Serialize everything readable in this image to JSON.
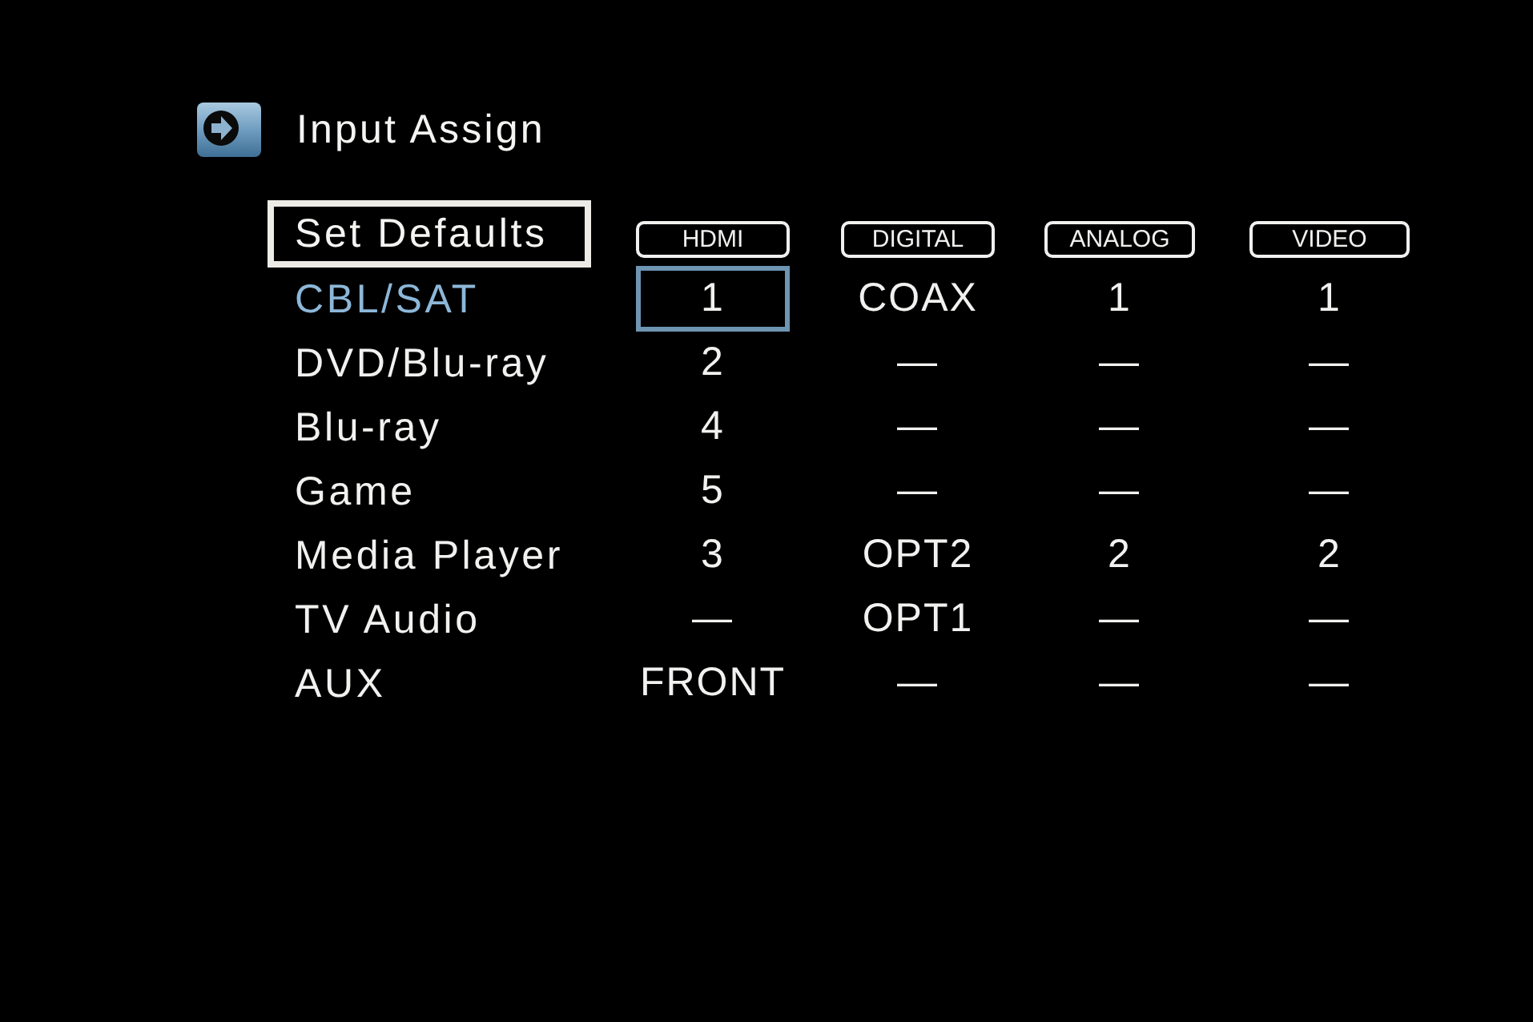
{
  "header": {
    "title": "Input Assign"
  },
  "set_defaults": {
    "label": "Set Defaults"
  },
  "columns": [
    {
      "label": "HDMI"
    },
    {
      "label": "DIGITAL"
    },
    {
      "label": "ANALOG"
    },
    {
      "label": "VIDEO"
    }
  ],
  "rows": [
    {
      "source": "CBL/SAT",
      "selected": true,
      "cells": [
        {
          "value": "1",
          "selected": true
        },
        {
          "value": "COAX",
          "selected": false
        },
        {
          "value": "1",
          "selected": false
        },
        {
          "value": "1",
          "selected": false
        }
      ]
    },
    {
      "source": "DVD/Blu-ray",
      "selected": false,
      "cells": [
        {
          "value": "2",
          "selected": false
        },
        {
          "value": "—",
          "selected": false
        },
        {
          "value": "—",
          "selected": false
        },
        {
          "value": "—",
          "selected": false
        }
      ]
    },
    {
      "source": "Blu-ray",
      "selected": false,
      "cells": [
        {
          "value": "4",
          "selected": false
        },
        {
          "value": "—",
          "selected": false
        },
        {
          "value": "—",
          "selected": false
        },
        {
          "value": "—",
          "selected": false
        }
      ]
    },
    {
      "source": "Game",
      "selected": false,
      "cells": [
        {
          "value": "5",
          "selected": false
        },
        {
          "value": "—",
          "selected": false
        },
        {
          "value": "—",
          "selected": false
        },
        {
          "value": "—",
          "selected": false
        }
      ]
    },
    {
      "source": "Media Player",
      "selected": false,
      "cells": [
        {
          "value": "3",
          "selected": false
        },
        {
          "value": "OPT2",
          "selected": false
        },
        {
          "value": "2",
          "selected": false
        },
        {
          "value": "2",
          "selected": false
        }
      ]
    },
    {
      "source": "TV Audio",
      "selected": false,
      "cells": [
        {
          "value": "—",
          "selected": false
        },
        {
          "value": "OPT1",
          "selected": false
        },
        {
          "value": "—",
          "selected": false
        },
        {
          "value": "—",
          "selected": false
        }
      ]
    },
    {
      "source": "AUX",
      "selected": false,
      "cells": [
        {
          "value": "FRONT",
          "selected": false
        },
        {
          "value": "—",
          "selected": false
        },
        {
          "value": "—",
          "selected": false
        },
        {
          "value": "—",
          "selected": false
        }
      ]
    }
  ]
}
